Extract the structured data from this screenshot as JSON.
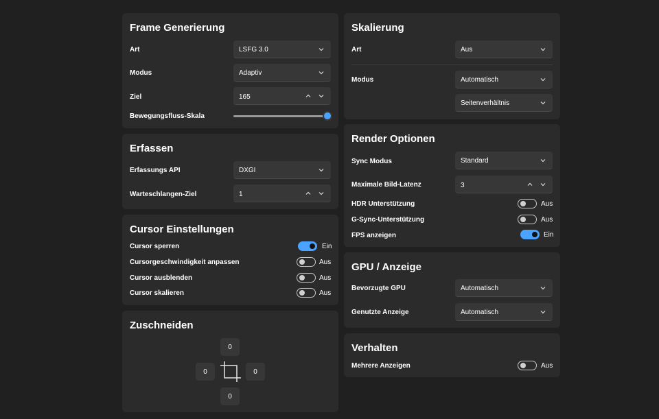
{
  "frame_gen": {
    "title": "Frame Generierung",
    "art": {
      "label": "Art",
      "value": "LSFG 3.0"
    },
    "modus": {
      "label": "Modus",
      "value": "Adaptiv"
    },
    "ziel": {
      "label": "Ziel",
      "value": "165"
    },
    "flow_scale": {
      "label": "Bewegungsfluss-Skala",
      "level": 1.0
    }
  },
  "capture": {
    "title": "Erfassen",
    "api": {
      "label": "Erfassungs API",
      "value": "DXGI"
    },
    "queue": {
      "label": "Warteschlangen-Ziel",
      "value": "1"
    }
  },
  "cursor": {
    "title": "Cursor Einstellungen",
    "items": [
      {
        "label": "Cursor sperren",
        "state": "Ein",
        "on": true
      },
      {
        "label": "Cursorgeschwindigkeit anpassen",
        "state": "Aus",
        "on": false
      },
      {
        "label": "Cursor ausblenden",
        "state": "Aus",
        "on": false
      },
      {
        "label": "Cursor skalieren",
        "state": "Aus",
        "on": false
      }
    ]
  },
  "crop": {
    "title": "Zuschneiden",
    "top": "0",
    "left": "0",
    "right": "0",
    "bottom": "0"
  },
  "scaling": {
    "title": "Skalierung",
    "art": {
      "label": "Art",
      "value": "Aus"
    },
    "modus": {
      "label": "Modus",
      "value": "Automatisch",
      "value2": "Seitenverhältnis"
    }
  },
  "render": {
    "title": "Render Optionen",
    "sync": {
      "label": "Sync Modus",
      "value": "Standard"
    },
    "latency": {
      "label": "Maximale Bild-Latenz",
      "value": "3"
    },
    "toggles": [
      {
        "label": "HDR Unterstützung",
        "state": "Aus",
        "on": false
      },
      {
        "label": "G-Sync-Unterstützung",
        "state": "Aus",
        "on": false
      },
      {
        "label": "FPS anzeigen",
        "state": "Ein",
        "on": true
      }
    ]
  },
  "gpu": {
    "title": "GPU / Anzeige",
    "gpu": {
      "label": "Bevorzugte GPU",
      "value": "Automatisch"
    },
    "display": {
      "label": "Genutzte Anzeige",
      "value": "Automatisch"
    }
  },
  "behavior": {
    "title": "Verhalten",
    "multi": {
      "label": "Mehrere Anzeigen",
      "state": "Aus",
      "on": false
    }
  },
  "colors": {
    "accent": "#4aa3ff",
    "card": "#2b2b2b",
    "background": "#202020"
  }
}
